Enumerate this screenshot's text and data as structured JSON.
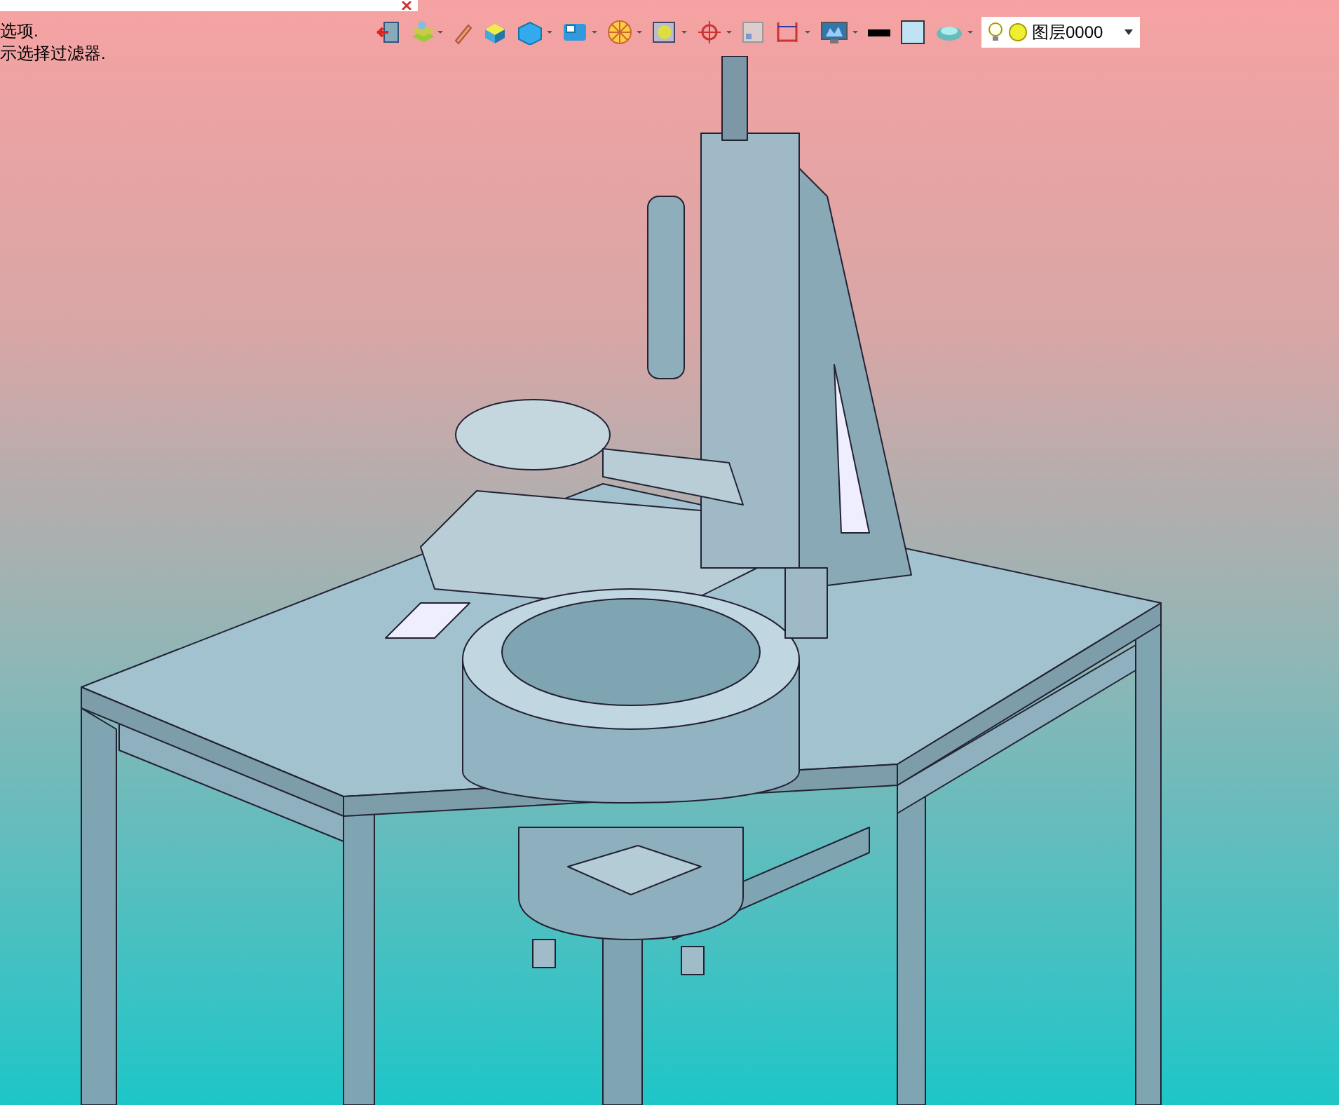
{
  "prompt_lines": [
    "选项.",
    "示选择过滤器."
  ],
  "layer_field": {
    "value": "图层0000"
  }
}
